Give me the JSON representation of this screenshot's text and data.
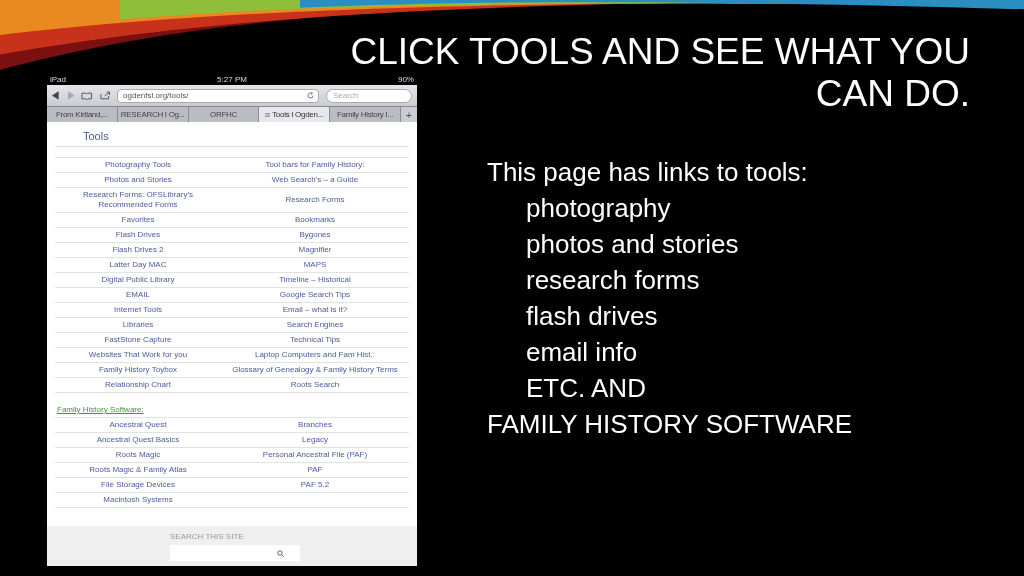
{
  "title_lines": [
    "CLICK TOOLS AND SEE WHAT YOU",
    "CAN DO."
  ],
  "body": [
    {
      "text": "This page has links to tools:",
      "indent": false
    },
    {
      "text": "photography",
      "indent": true
    },
    {
      "text": "photos and stories",
      "indent": true
    },
    {
      "text": "research forms",
      "indent": true
    },
    {
      "text": "flash drives",
      "indent": true
    },
    {
      "text": "email info",
      "indent": true
    },
    {
      "text": "ETC. AND",
      "indent": true
    },
    {
      "text": "FAMILY HISTORY SOFTWARE",
      "indent": false
    }
  ],
  "tablet": {
    "status_bar": {
      "device": "iPad",
      "time": "5:27 PM",
      "battery": "90%"
    },
    "address_bar": {
      "url": "ogdenfsl.org/tools/"
    },
    "search": {
      "placeholder": "Search"
    },
    "tabs": [
      {
        "label": "From Kirtland,...",
        "selected": false
      },
      {
        "label": "RESEARCH I Og...",
        "selected": false
      },
      {
        "label": "ORFHC",
        "selected": false
      },
      {
        "label": "Tools I Ogden...",
        "selected": true
      },
      {
        "label": "Family History I...",
        "selected": false
      }
    ],
    "new_tab": "+",
    "page": {
      "heading": "Tools",
      "rows": [
        [
          "Photography Tools",
          "Tool bars for Family History:"
        ],
        [
          "Photos and Stories",
          "Web Search’s – a Guide"
        ],
        [
          "Research Forms: OFSLibrary’s Recommended Forms",
          "Research Forms"
        ],
        [
          "Favorites",
          "Bookmarks"
        ],
        [
          "Flash Drives",
          "Bygones"
        ],
        [
          "Flash Drives 2",
          "Magnifier"
        ],
        [
          "Latter Day MAC",
          "MAPS"
        ],
        [
          "Digital Public Library",
          "Timeline – Historical"
        ],
        [
          "EMAIL",
          "Google Search Tips"
        ],
        [
          "Internet Tools",
          "Email – what is it?"
        ],
        [
          "Libraries",
          "Search Engines"
        ],
        [
          "FastStone Capture",
          "Technical Tips"
        ],
        [
          "Websites That Work for you",
          "Laptop Computers and Fam Hist.:"
        ],
        [
          "Family History Toybox",
          "Glossary of Genealogy & Family History Terms"
        ],
        [
          "Relationship Chart",
          "Roots Search"
        ]
      ],
      "section_heading": "Family History Software:",
      "section_rows": [
        [
          "Ancestral Quest",
          "Branches"
        ],
        [
          "Ancestral Quest Basics",
          "Legacy"
        ],
        [
          "Roots Magic",
          "Personal Ancestral File (PAF)"
        ],
        [
          "Roots Magic & Family Atlas",
          "PAF"
        ],
        [
          "File Storage Devices",
          "PAF 5.2"
        ],
        [
          "Macintosh Systems"
        ]
      ]
    },
    "footer": {
      "label": "SEARCH THIS SITE"
    }
  }
}
